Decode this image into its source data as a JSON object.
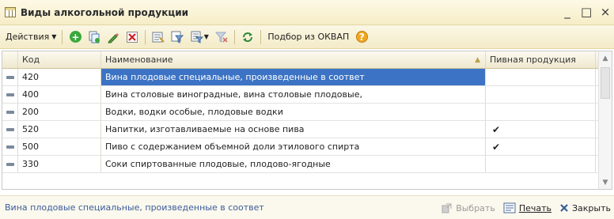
{
  "window": {
    "title": "Виды алкогольной продукции",
    "minimize": "_",
    "maximize": "□",
    "close": "×"
  },
  "toolbar": {
    "actions_label": "Действия",
    "okvap_label": "Подбор из ОКВАП"
  },
  "table": {
    "columns": {
      "code": "Код",
      "name": "Наименование",
      "beer": "Пивная продукция"
    },
    "rows": [
      {
        "code": "420",
        "name": "Вина плодовые специальные, произведенные в соответ",
        "beer": ""
      },
      {
        "code": "400",
        "name": "Вина столовые виноградные, вина столовые плодовые,",
        "beer": ""
      },
      {
        "code": "200",
        "name": "Водки, водки особые, плодовые водки",
        "beer": ""
      },
      {
        "code": "520",
        "name": "Напитки, изготавливаемые на основе пива",
        "beer": "✔"
      },
      {
        "code": "500",
        "name": "Пиво с содержанием объемной доли этилового спирта",
        "beer": "✔"
      },
      {
        "code": "330",
        "name": "Соки спиртованные плодовые, плодово-ягодные",
        "beer": ""
      }
    ]
  },
  "footer": {
    "status": "Вина плодовые специальные, произведенные в соответ",
    "select_label": "Выбрать",
    "print_label": "Печать",
    "close_label": "Закрыть"
  },
  "colors": {
    "selection": "#3c73c4",
    "title_bg": "#f6edc6",
    "status_text": "#3a5c9a"
  }
}
